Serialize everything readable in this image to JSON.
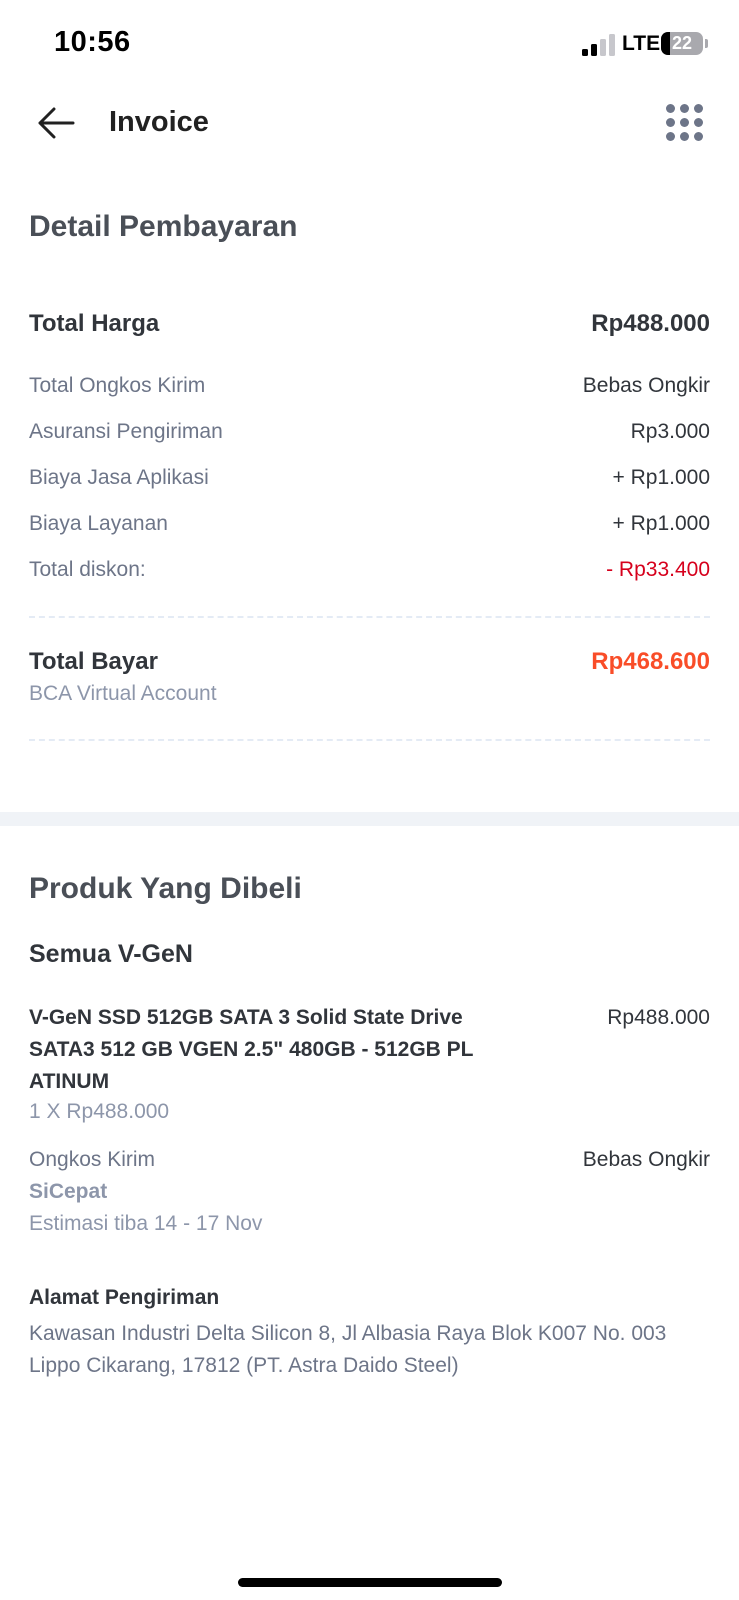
{
  "status_bar": {
    "time": "10:56",
    "network": "LTE",
    "battery": "22",
    "signal_bars_on": 2,
    "signal_bars_total": 4
  },
  "header": {
    "title": "Invoice",
    "back_icon": "arrow-left-icon",
    "menu_icon": "grid-menu-icon"
  },
  "payment": {
    "title": "Detail Pembayaran",
    "total_price": {
      "label": "Total Harga",
      "value": "Rp488.000"
    },
    "rows": [
      {
        "label": "Total Ongkos Kirim",
        "value": "Bebas Ongkir"
      },
      {
        "label": "Asuransi Pengiriman",
        "value": "Rp3.000"
      },
      {
        "label": "Biaya Jasa Aplikasi",
        "value": "+ Rp1.000"
      },
      {
        "label": "Biaya Layanan",
        "value": "+ Rp1.000"
      },
      {
        "label": "Total diskon:",
        "value": "- Rp33.400"
      }
    ],
    "total_pay": {
      "label": "Total Bayar",
      "value": "Rp468.600",
      "method": "BCA Virtual Account"
    }
  },
  "products": {
    "title": "Produk Yang Dibeli",
    "store": "Semua V-GeN",
    "item": {
      "name": "V-GeN SSD 512GB SATA 3 Solid State Drive SATA3 512 GB VGEN 2.5\" 480GB - 512GB PL ATINUM",
      "price": "Rp488.000",
      "qty": "1 X Rp488.000"
    },
    "shipping": {
      "label": "Ongkos Kirim",
      "value": "Bebas Ongkir",
      "courier": "SiCepat",
      "eta": "Estimasi tiba 14 - 17 Nov"
    },
    "address": {
      "title": "Alamat Pengiriman",
      "text": "Kawasan Industri Delta Silicon 8, Jl Albasia Raya Blok K007 No. 003 Lippo Cikarang, 17812 (PT. Astra Daido Steel)"
    }
  },
  "colors": {
    "discount": "#d6001c",
    "total_pay": "#f94d28",
    "divider": "#f0f3f7"
  }
}
